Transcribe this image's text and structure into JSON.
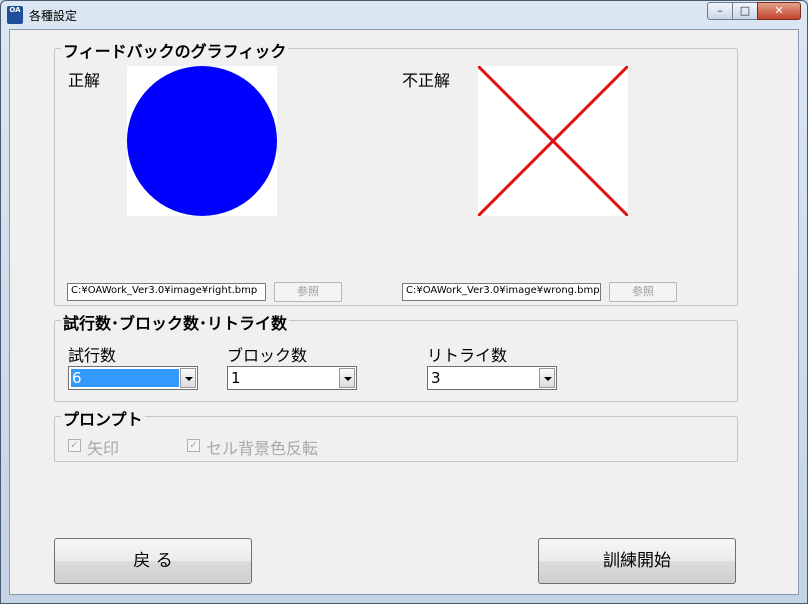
{
  "window": {
    "title": "各種設定",
    "icon_text": "OA",
    "minimize_glyph": "–",
    "maximize_glyph": "□",
    "close_glyph": "✕"
  },
  "feedback": {
    "group_title": "フィードバックのグラフィック",
    "correct_label": "正解",
    "incorrect_label": "不正解",
    "correct_path": "C:¥OAWork_Ver3.0¥image¥right.bmp",
    "incorrect_path": "C:¥OAWork_Ver3.0¥image¥wrong.bmp",
    "browse_label": "参照",
    "correct_image": "blue-circle",
    "incorrect_image": "red-x",
    "circle_color": "#0000ff",
    "cross_color": "#e01010"
  },
  "trials": {
    "group_title": "試行数･ブロック数･リトライ数",
    "trials_label": "試行数",
    "trials_value": "6",
    "blocks_label": "ブロック数",
    "blocks_value": "1",
    "retries_label": "リトライ数",
    "retries_value": "3"
  },
  "prompt": {
    "group_title": "プロンプト",
    "arrow_label": "矢印",
    "arrow_checked": true,
    "cell_bg_label": "セル背景色反転",
    "cell_bg_checked": true,
    "check_glyph": "✓"
  },
  "buttons": {
    "back_label": "戻 る",
    "start_label": "訓練開始"
  }
}
